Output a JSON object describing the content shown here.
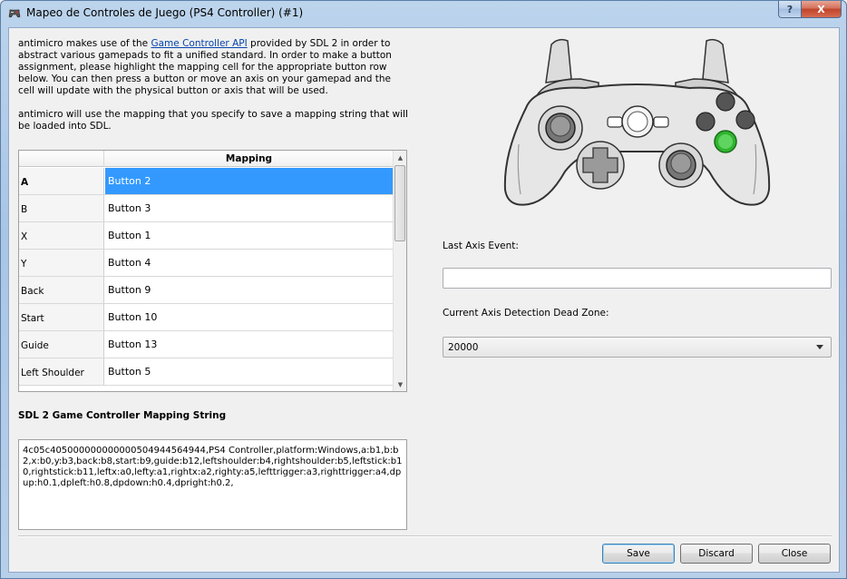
{
  "window": {
    "title": "Mapeo de Controles de Juego (PS4 Controller) (#1)",
    "help_glyph": "?",
    "close_glyph": "X"
  },
  "intro": {
    "p1_before": "antimicro makes use of the ",
    "p1_link": "Game Controller API",
    "p1_after": " provided by SDL 2 in order to abstract various gamepads to fit a unified standard. In order to make a button assignment, please highlight the mapping cell for the appropriate button row below. You can then press a button or move an axis on your gamepad and the cell will update with the physical button or axis that will be used.",
    "p2": "antimicro will use the mapping that you specify to save a mapping string that will be loaded into SDL."
  },
  "table": {
    "column_header": "Mapping",
    "rows": [
      {
        "label": "A",
        "value": "Button 2"
      },
      {
        "label": "B",
        "value": "Button 3"
      },
      {
        "label": "X",
        "value": "Button 1"
      },
      {
        "label": "Y",
        "value": "Button 4"
      },
      {
        "label": "Back",
        "value": "Button 9"
      },
      {
        "label": "Start",
        "value": "Button 10"
      },
      {
        "label": "Guide",
        "value": "Button 13"
      },
      {
        "label": "Left Shoulder",
        "value": "Button 5"
      }
    ],
    "selected_row": 0,
    "scroll_up_glyph": "▲",
    "scroll_down_glyph": "▼"
  },
  "mapping_string": {
    "label": "SDL 2 Game Controller Mapping String",
    "value": "4c05c405000000000000504944564944,PS4 Controller,platform:Windows,a:b1,b:b2,x:b0,y:b3,back:b8,start:b9,guide:b12,leftshoulder:b4,rightshoulder:b5,leftstick:b10,rightstick:b11,leftx:a0,lefty:a1,rightx:a2,righty:a5,lefttrigger:a3,righttrigger:a4,dpup:h0.1,dpleft:h0.8,dpdown:h0.4,dpright:h0.2,"
  },
  "axis": {
    "last_event_label": "Last Axis Event:",
    "last_event_value": ""
  },
  "dead_zone": {
    "label": "Current Axis Detection Dead Zone:",
    "value": "20000"
  },
  "buttons": {
    "save": "Save",
    "discard": "Discard",
    "close": "Close"
  },
  "colors": {
    "selection": "#3399ff",
    "highlight_button": "#2fb52f",
    "controller_body": "#e6e6e6"
  }
}
